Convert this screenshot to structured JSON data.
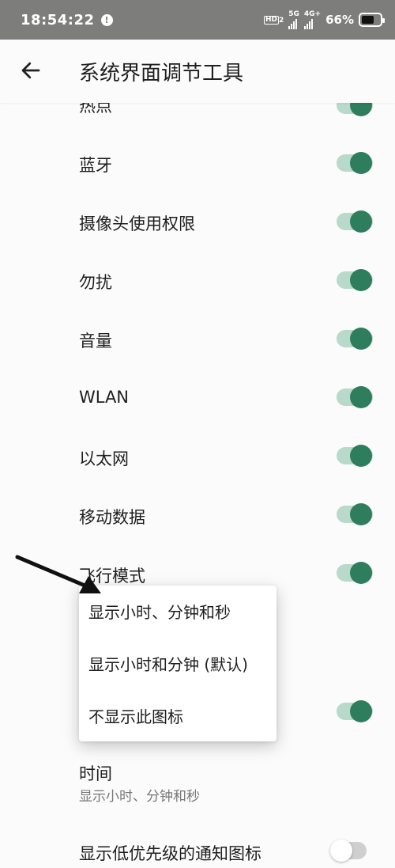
{
  "status_bar": {
    "time": "18:54:22",
    "alert": "!",
    "hd": "HD",
    "hd_sub": "2",
    "net1": "5G",
    "net2": "4G+",
    "battery": "66%",
    "battery_level": 0.66
  },
  "app_bar": {
    "title": "系统界面调节工具",
    "back_icon": "arrow-left-icon"
  },
  "toggles": [
    {
      "label": "热点",
      "on": true
    },
    {
      "label": "蓝牙",
      "on": true
    },
    {
      "label": "摄像头使用权限",
      "on": true
    },
    {
      "label": "勿扰",
      "on": true
    },
    {
      "label": "音量",
      "on": true
    },
    {
      "label": "WLAN",
      "on": true
    },
    {
      "label": "以太网",
      "on": true
    },
    {
      "label": "移动数据",
      "on": true
    },
    {
      "label": "飞行模式",
      "on": true
    }
  ],
  "hidden_row": {
    "on": true
  },
  "time_row": {
    "title": "时间",
    "subtitle": "显示小时、分钟和秒"
  },
  "low_priority_row": {
    "label": "显示低优先级的通知图标",
    "on": false
  },
  "menu": {
    "options": [
      "显示小时、分钟和秒",
      "显示小时和分钟 (默认)",
      "不显示此图标"
    ]
  },
  "colors": {
    "accent": "#2e7d5d",
    "track_on": "#b9d9cb",
    "status_bar": "#7d7d7b"
  }
}
